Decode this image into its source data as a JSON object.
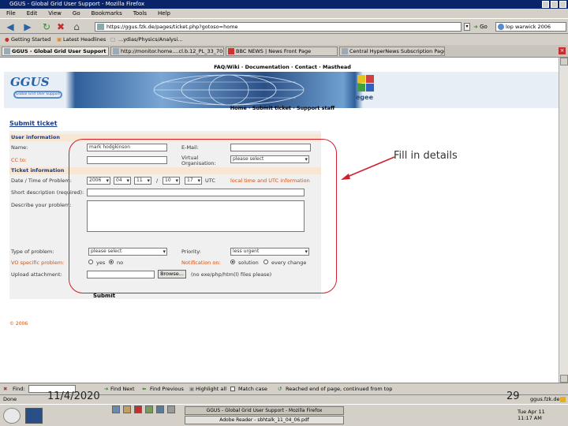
{
  "window": {
    "title": "GGUS - Global Grid User Support - Mozilla Firefox"
  },
  "menu": [
    "File",
    "Edit",
    "View",
    "Go",
    "Bookmarks",
    "Tools",
    "Help"
  ],
  "nav": {
    "url": "https://ggus.fzk.de/pages/ticket.php?gotoso=home",
    "go_label": "Go",
    "search_value": "lop warwick 2006"
  },
  "bookmarks": [
    "Getting Started",
    "Latest Headlines",
    "...ydias/Physics/Analysi..."
  ],
  "tabs": [
    {
      "label": "GGUS - Global Grid User Support",
      "active": true
    },
    {
      "label": "http://monitor.home....cl.b.12_PL_33_70",
      "active": false
    },
    {
      "label": "BBC NEWS | News Front Page",
      "active": false
    },
    {
      "label": "Central HyperNews Subscription Page",
      "active": false
    }
  ],
  "page": {
    "top_links": "FAQ/Wiki · Documentation · Contact · Masthead",
    "logo": "GGUS",
    "logo_sub": "Global Grid User Support",
    "egee": "egee",
    "sub_links": "Home · Submit ticket · Support staff",
    "section_title": "Submit ticket",
    "user_info_header": "User information",
    "name_label": "Name:",
    "name_value": "mark hodgkinson",
    "email_label": "E-Mail:",
    "cc_label": "CC to:",
    "vo_label": "Virtual Organisation:",
    "vo_value": "please select",
    "ticket_info_header": "Ticket information",
    "date_label": "Date / Time of Problem:",
    "date_year": "2006",
    "date_month": "04",
    "date_day": "11",
    "date_to": "/",
    "date_hour": "10",
    "date_min": "17",
    "date_tz": "UTC",
    "date_note": "local time and UTC information",
    "short_desc_label": "Short description (required):",
    "describe_label": "Describe your problem:",
    "type_label": "Type of problem:",
    "type_value": "please select",
    "priority_label": "Priority:",
    "priority_value": "less urgent",
    "vo_specific_label": "VO specific problem:",
    "yes_label": "yes",
    "no_label": "no",
    "notification_label": "Notification on:",
    "notif_solution": "solution",
    "notif_every": "every change",
    "upload_label": "Upload attachment:",
    "browse_label": "Browse...",
    "upload_note": "(no exe/php/htm(l) files please)",
    "submit_label": "Submit",
    "copyright": "© 2006"
  },
  "annotation": {
    "text": "Fill in details"
  },
  "findbar": {
    "find_label": "Find:",
    "find_next": "Find Next",
    "find_previous": "Find Previous",
    "highlight": "Highlight all",
    "match_case": "Match case",
    "status": "Reached end of page, continued from top"
  },
  "statusbar": {
    "done": "Done",
    "site": "ggus.fzk.de"
  },
  "slide": {
    "date": "11/4/2020",
    "page_number": "29"
  },
  "taskbar": {
    "task1": "GGUS - Global Grid User Support - Mozilla Firefox",
    "task2": "Adobe Reader - sbhtalk_11_04_06.pdf",
    "clock_day": "Tue Apr 11",
    "clock_time": "11:17 AM"
  },
  "colors": {
    "accent": "#1a3a8a",
    "highlight": "#d02030",
    "required": "#d05010",
    "section_bg": "#f6e6d2"
  }
}
